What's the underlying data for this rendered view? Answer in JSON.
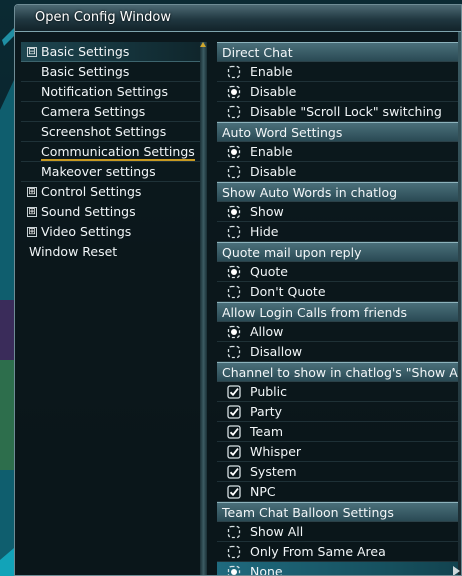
{
  "window": {
    "title": "Open Config Window"
  },
  "nav": {
    "categories": [
      {
        "label": "Basic Settings",
        "expanded": true,
        "marker": "⊟",
        "items": [
          {
            "label": "Basic Settings"
          },
          {
            "label": "Notification Settings"
          },
          {
            "label": "Camera Settings"
          },
          {
            "label": "Screenshot Settings"
          },
          {
            "label": "Communication Settings",
            "active": true
          },
          {
            "label": "Makeover settings"
          }
        ]
      },
      {
        "label": "Control Settings",
        "expanded": false,
        "marker": "⊞"
      },
      {
        "label": "Sound Settings",
        "expanded": false,
        "marker": "⊞"
      },
      {
        "label": "Video Settings",
        "expanded": false,
        "marker": "⊞"
      }
    ],
    "window_reset": "Window Reset"
  },
  "sections": [
    {
      "title": "Direct Chat",
      "type": "radio",
      "options": [
        {
          "label": "Enable",
          "selected": false
        },
        {
          "label": "Disable",
          "selected": true
        },
        {
          "label": "Disable \"Scroll Lock\" switching",
          "selected": false,
          "kind": "checkbox"
        }
      ]
    },
    {
      "title": "Auto Word Settings",
      "type": "radio",
      "options": [
        {
          "label": "Enable",
          "selected": true
        },
        {
          "label": "Disable",
          "selected": false
        }
      ]
    },
    {
      "title": "Show Auto Words in chatlog",
      "type": "radio",
      "options": [
        {
          "label": "Show",
          "selected": true
        },
        {
          "label": "Hide",
          "selected": false
        }
      ]
    },
    {
      "title": "Quote mail upon reply",
      "type": "radio",
      "options": [
        {
          "label": "Quote",
          "selected": true
        },
        {
          "label": "Don't Quote",
          "selected": false
        }
      ]
    },
    {
      "title": "Allow Login Calls from friends",
      "type": "radio",
      "options": [
        {
          "label": "Allow",
          "selected": true
        },
        {
          "label": "Disallow",
          "selected": false
        }
      ]
    },
    {
      "title": "Channel to show in chatlog's \"Show All",
      "type": "checkbox",
      "options": [
        {
          "label": "Public",
          "checked": true
        },
        {
          "label": "Party",
          "checked": true
        },
        {
          "label": "Team",
          "checked": true
        },
        {
          "label": "Whisper",
          "checked": true
        },
        {
          "label": "System",
          "checked": true
        },
        {
          "label": "NPC",
          "checked": true
        }
      ]
    },
    {
      "title": "Team Chat Balloon Settings",
      "type": "radio",
      "options": [
        {
          "label": "Show All",
          "selected": false
        },
        {
          "label": "Only From Same Area",
          "selected": false
        },
        {
          "label": "None",
          "selected": true,
          "highlighted": true
        }
      ]
    }
  ],
  "colors": {
    "accent_underline": "#c89a22",
    "header_bg": "#3a5f6a",
    "highlight_row": "#1f6a7e"
  }
}
